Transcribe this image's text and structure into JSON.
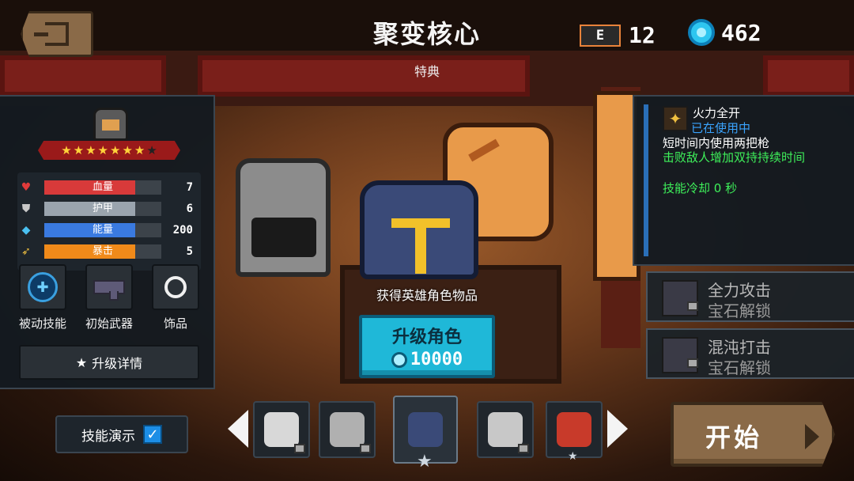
{
  "header": {
    "title": "聚变核心",
    "subtitle": "特典",
    "energy_icon_text": "E",
    "energy_count": "12",
    "gem_count": "462"
  },
  "character": {
    "star_count_filled": 7,
    "star_count_total": 8,
    "stats": [
      {
        "label": "血量",
        "value": "7",
        "icon": "heart-icon",
        "color": "#d83a3a",
        "fill": 0.78
      },
      {
        "label": "护甲",
        "value": "6",
        "icon": "armor-icon",
        "color": "#9aa4ae",
        "fill": 0.78
      },
      {
        "label": "能量",
        "value": "200",
        "icon": "energy-crystal-icon",
        "color": "#3a7ae0",
        "fill": 0.78
      },
      {
        "label": "暴击",
        "value": "5",
        "icon": "crit-icon",
        "color": "#f08a1a",
        "fill": 0.78
      }
    ],
    "slots": [
      {
        "label": "被动技能",
        "icon": "shield-icon"
      },
      {
        "label": "初始武器",
        "icon": "gun-icon"
      },
      {
        "label": "饰品",
        "icon": "ring-icon"
      }
    ],
    "upgrade_detail_label": "升级详情",
    "acquired_text": "获得英雄角色物品",
    "upgrade_button_label": "升级角色",
    "upgrade_cost": "10000"
  },
  "skill": {
    "name": "火力全开",
    "status": "已在使用中",
    "description": "短时间内使用两把枪",
    "effect": "击败敌人增加双持持续时间",
    "cooldown": "技能冷却 0 秒"
  },
  "locked_skills": [
    {
      "name": "全力攻击",
      "status": "宝石解锁"
    },
    {
      "name": "混沌打击",
      "status": "宝石解锁"
    }
  ],
  "bottom": {
    "skill_demo_label": "技能演示",
    "skill_demo_checked": true,
    "start_label": "开始"
  },
  "hero_carousel": [
    {
      "name": "panda",
      "color": "#d8d8d8",
      "locked": true
    },
    {
      "name": "robot",
      "color": "#b0b0b0",
      "locked": true
    },
    {
      "name": "paladin",
      "color": "#3a4a78",
      "locked": false,
      "selected": true
    },
    {
      "name": "werewolf",
      "color": "#c8c8c8",
      "locked": true
    },
    {
      "name": "berserker",
      "color": "#c83a2a",
      "locked": false
    }
  ]
}
